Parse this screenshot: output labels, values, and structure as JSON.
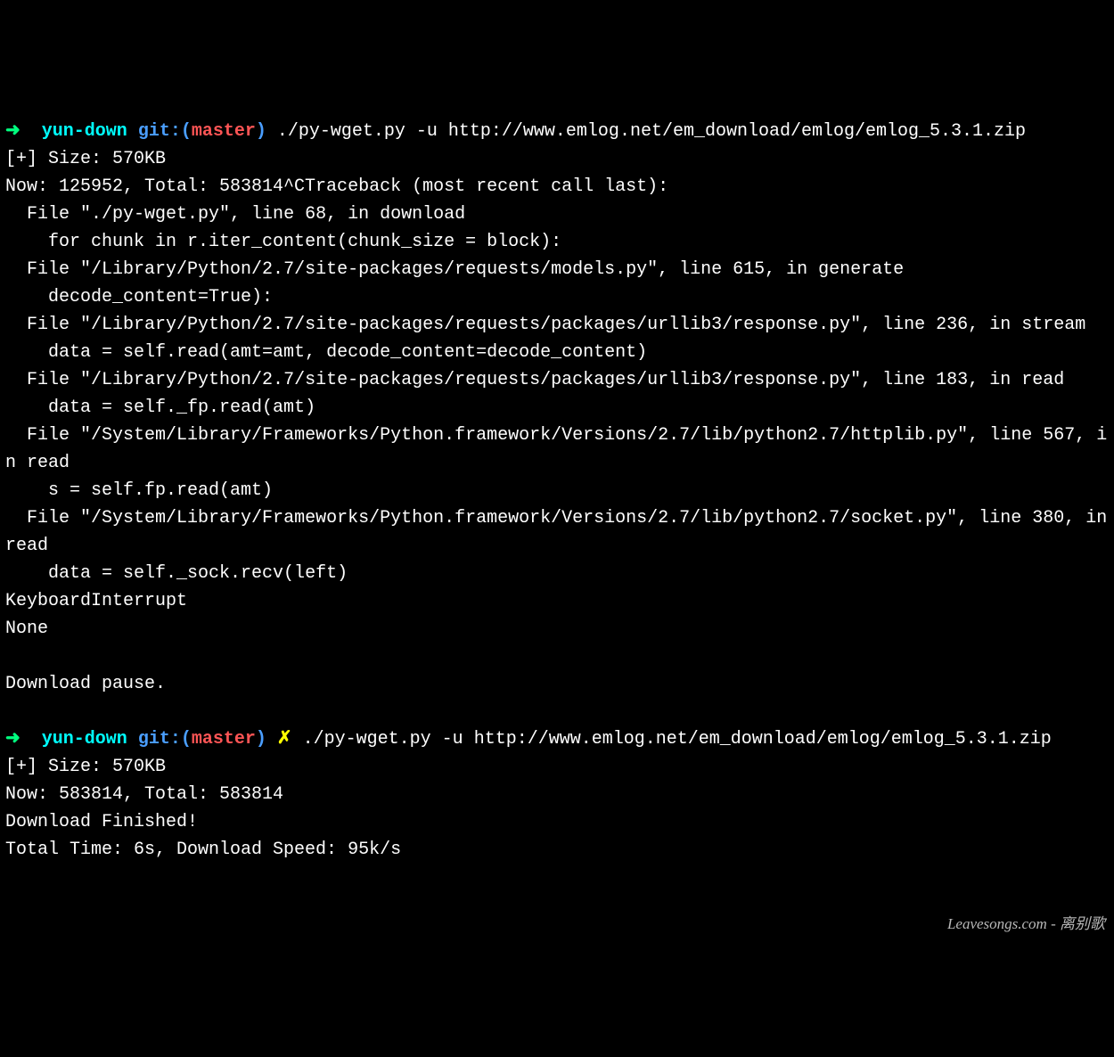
{
  "prompt1": {
    "arrow": "➜",
    "dir": "yun-down",
    "git_label": "git:(",
    "branch": "master",
    "git_close": ")",
    "command": "./py-wget.py -u http://www.emlog.net/em_download/emlog/emlog_5.3.1.zip"
  },
  "output1": {
    "size_line": "[+] Size: 570KB",
    "progress_line": "Now: 125952, Total: 583814^CTraceback (most recent call last):",
    "tb_line1": "  File \"./py-wget.py\", line 68, in download",
    "tb_line2": "    for chunk in r.iter_content(chunk_size = block):",
    "tb_line3": "  File \"/Library/Python/2.7/site-packages/requests/models.py\", line 615, in generate",
    "tb_line4": "    decode_content=True):",
    "tb_line5": "  File \"/Library/Python/2.7/site-packages/requests/packages/urllib3/response.py\", line 236, in stream",
    "tb_line6": "    data = self.read(amt=amt, decode_content=decode_content)",
    "tb_line7": "  File \"/Library/Python/2.7/site-packages/requests/packages/urllib3/response.py\", line 183, in read",
    "tb_line8": "    data = self._fp.read(amt)",
    "tb_line9": "  File \"/System/Library/Frameworks/Python.framework/Versions/2.7/lib/python2.7/httplib.py\", line 567, in read",
    "tb_line10": "    s = self.fp.read(amt)",
    "tb_line11": "  File \"/System/Library/Frameworks/Python.framework/Versions/2.7/lib/python2.7/socket.py\", line 380, in read",
    "tb_line12": "    data = self._sock.recv(left)",
    "tb_line13": "KeyboardInterrupt",
    "tb_line14": "None",
    "blank": "",
    "pause": "Download pause."
  },
  "prompt2": {
    "arrow": "➜",
    "dir": "yun-down",
    "git_label": "git:(",
    "branch": "master",
    "git_close": ")",
    "x": "✗",
    "command": "./py-wget.py -u http://www.emlog.net/em_download/emlog/emlog_5.3.1.zip"
  },
  "output2": {
    "size_line": "[+] Size: 570KB",
    "progress_line": "Now: 583814, Total: 583814",
    "finished": "Download Finished!",
    "speed": "Total Time: 6s, Download Speed: 95k/s"
  },
  "watermark": "Leavesongs.com - 离别歌"
}
